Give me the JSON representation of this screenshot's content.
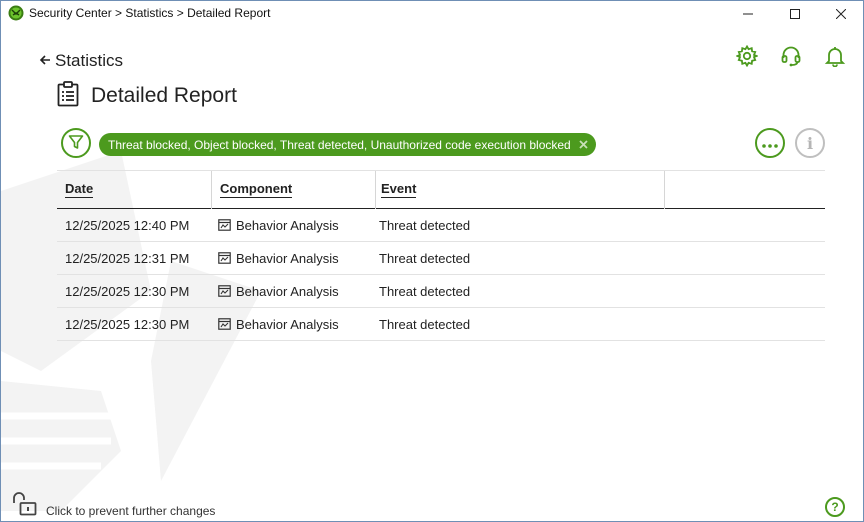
{
  "window": {
    "title": "Security Center > Statistics > Detailed Report",
    "app_icon": "dr-web-spider-icon"
  },
  "nav": {
    "back_label": "Statistics"
  },
  "header_icons": [
    "gear-icon",
    "headset-icon",
    "bell-icon"
  ],
  "page": {
    "title": "Detailed Report"
  },
  "filter": {
    "chip_label": "Threat blocked, Object blocked, Threat detected, Unauthorized code execution blocked",
    "info_glyph": "i"
  },
  "table": {
    "columns": [
      "Date",
      "Component",
      "Event"
    ],
    "rows": [
      {
        "date": "12/25/2025 12:40 PM",
        "component": "Behavior Analysis",
        "event": "Threat detected"
      },
      {
        "date": "12/25/2025 12:31 PM",
        "component": "Behavior Analysis",
        "event": "Threat detected"
      },
      {
        "date": "12/25/2025 12:30 PM",
        "component": "Behavior Analysis",
        "event": "Threat detected"
      },
      {
        "date": "12/25/2025 12:30 PM",
        "component": "Behavior Analysis",
        "event": "Threat detected"
      }
    ]
  },
  "footer": {
    "lock_label": "Click to prevent further changes",
    "help_glyph": "?"
  },
  "colors": {
    "accent": "#4c9a1e",
    "text": "#222222",
    "muted": "#bfbfbf"
  }
}
